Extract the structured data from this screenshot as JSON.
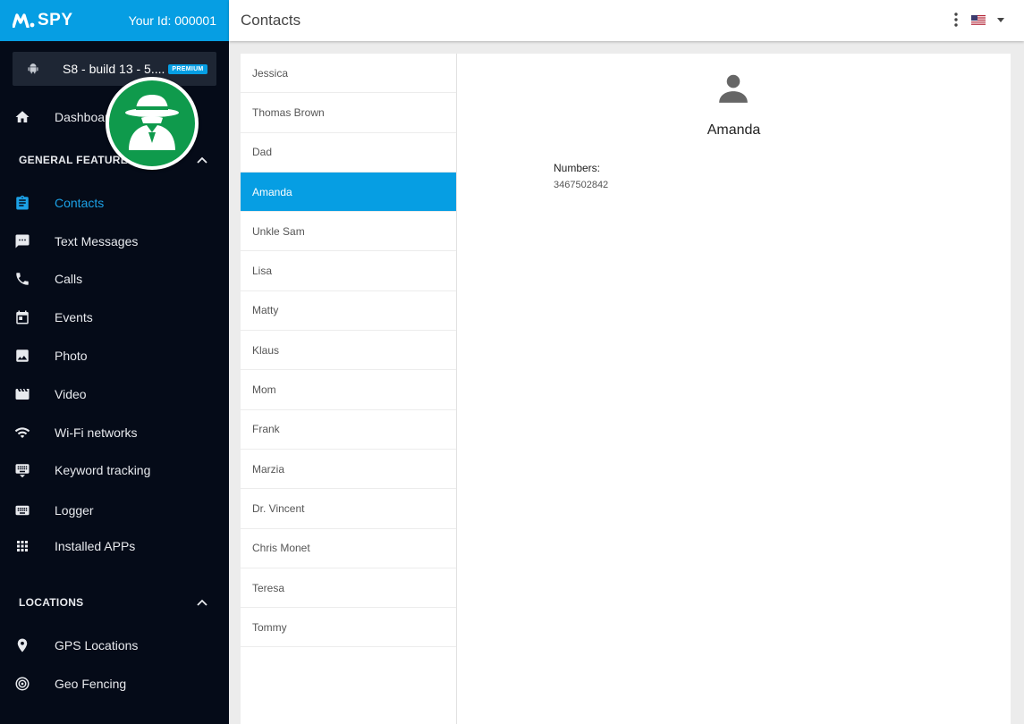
{
  "brand": {
    "logo_text": "SPY",
    "user_id": "Your Id: 000001"
  },
  "device": {
    "name": "S8 - build 13 - 5....",
    "badge": "PREMIUM"
  },
  "sidebar": {
    "dashboard": "Dashboard",
    "general_section": "GENERAL FEATURES",
    "general_items": [
      {
        "label": "Contacts",
        "icon": "clipboard-icon"
      },
      {
        "label": "Text Messages",
        "icon": "message-icon"
      },
      {
        "label": "Calls",
        "icon": "phone-icon"
      },
      {
        "label": "Events",
        "icon": "calendar-icon"
      },
      {
        "label": "Photo",
        "icon": "image-icon"
      },
      {
        "label": "Video",
        "icon": "film-icon"
      },
      {
        "label": "Wi-Fi networks",
        "icon": "wifi-icon"
      },
      {
        "label": "Keyword tracking",
        "icon": "keyboard-icon"
      },
      {
        "label": "Logger",
        "icon": "keyboard-icon"
      },
      {
        "label": "Installed APPs",
        "icon": "apps-grid-icon"
      }
    ],
    "locations_section": "LOCATIONS",
    "location_items": [
      {
        "label": "GPS Locations",
        "icon": "location-pin-icon"
      },
      {
        "label": "Geo Fencing",
        "icon": "target-icon"
      }
    ],
    "active_item": "Contacts"
  },
  "topbar": {
    "title": "Contacts",
    "language_flag": "us-flag-icon"
  },
  "contacts": [
    "Jessica",
    "Thomas Brown",
    "Dad",
    "Amanda",
    "Unkle Sam",
    "Lisa",
    "Matty",
    "Klaus",
    "Mom",
    "Frank",
    "Marzia",
    "Dr. Vincent",
    "Chris Monet",
    "Teresa",
    "Tommy"
  ],
  "selected_contact": {
    "name": "Amanda",
    "numbers_label": "Numbers:",
    "number": "3467502842"
  },
  "colors": {
    "accent": "#069ee3",
    "sidebar_bg": "#050b18",
    "badge_green": "#0f9a4c"
  }
}
